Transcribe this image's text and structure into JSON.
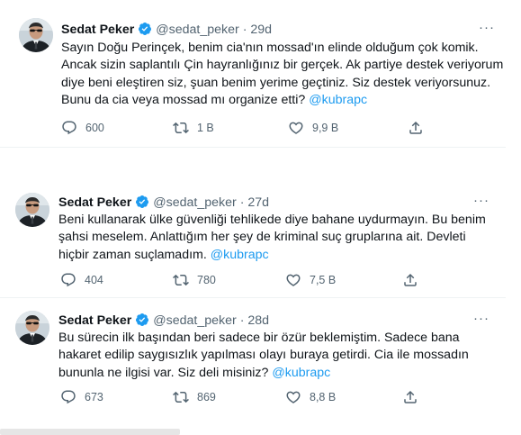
{
  "tweets": [
    {
      "name": "Sedat Peker",
      "handle": "@sedat_peker",
      "sep": "·",
      "time": "29d",
      "text_main": "Sayın Doğu Perinçek, benim cia'nın mossad'ın elinde olduğum çok komik. Ancak sizin saplantılı Çin hayranlığınız bir gerçek. Ak partiye destek veriyorum diye beni eleştiren siz, şuan benim yerime geçtiniz. Siz destek veriyorsunuz. Bunu da cia veya mossad mı organize etti?",
      "mention": "@kubrapc",
      "replies": "600",
      "retweets": "1 B",
      "likes": "9,9 B"
    },
    {
      "name": "Sedat Peker",
      "handle": "@sedat_peker",
      "sep": "·",
      "time": "27d",
      "text_main": "Beni kullanarak ülke güvenliği tehlikede diye bahane uydurmayın. Bu benim şahsi meselem. Anlattığım her şey de kriminal suç gruplarına ait. Devleti hiçbir zaman suçlamadım.",
      "mention": "@kubrapc",
      "replies": "404",
      "retweets": "780",
      "likes": "7,5 B"
    },
    {
      "name": "Sedat Peker",
      "handle": "@sedat_peker",
      "sep": "·",
      "time": "28d",
      "text_main": "Bu sürecin ilk başından beri sadece bir özür beklemiştim. Sadece bana hakaret edilip saygısızlık yapılması olayı buraya getirdi. Cia ile mossadın bununla ne ilgisi var. Siz deli misiniz?",
      "mention": "@kubrapc",
      "replies": "673",
      "retweets": "869",
      "likes": "8,8 B"
    }
  ],
  "more_label": "···",
  "icons": {
    "verified": "verified-badge-icon",
    "reply": "reply-icon",
    "retweet": "retweet-icon",
    "like": "heart-icon",
    "share": "share-icon"
  },
  "colors": {
    "accent": "#1d9bf0",
    "secondary_text": "#536471",
    "divider": "#eff3f4"
  }
}
